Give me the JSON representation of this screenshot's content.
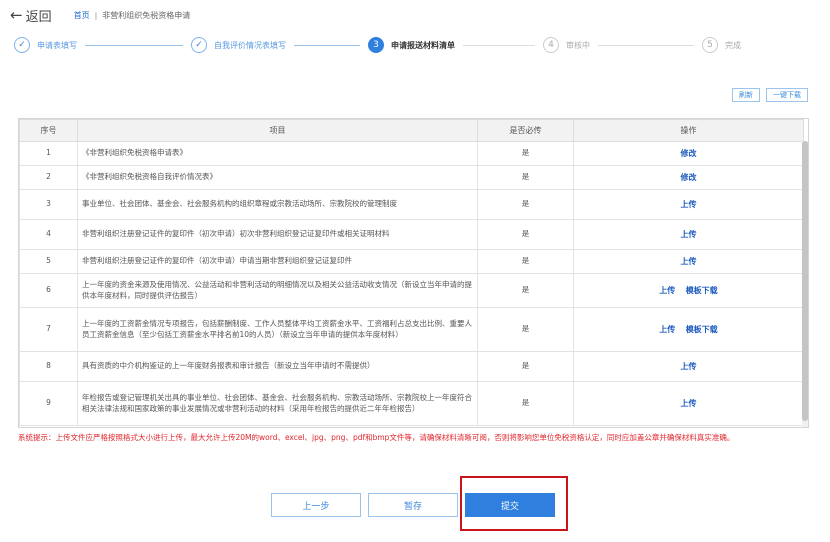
{
  "header": {
    "back_label": "返回",
    "breadcrumb": {
      "home": "首页",
      "separator": "|",
      "current": "非营利组织免税资格申请"
    }
  },
  "steps": [
    {
      "number": "✓",
      "label": "申请表填写",
      "state": "done"
    },
    {
      "number": "✓",
      "label": "自我评价情况表填写",
      "state": "done"
    },
    {
      "number": "3",
      "label": "申请报送材料清单",
      "state": "active"
    },
    {
      "number": "4",
      "label": "审核中",
      "state": "todo"
    },
    {
      "number": "5",
      "label": "完成",
      "state": "todo"
    }
  ],
  "actions": {
    "refresh_label": "刷新",
    "download_all_label": "一键下载"
  },
  "table": {
    "headers": [
      "序号",
      "项目",
      "是否必传",
      "操作"
    ],
    "rows": [
      {
        "idx": "1",
        "item": "《非营利组织免税资格申请表》",
        "required": "是",
        "ops": [
          "修改"
        ]
      },
      {
        "idx": "2",
        "item": "《非营利组织免税资格自我评价情况表》",
        "required": "是",
        "ops": [
          "修改"
        ]
      },
      {
        "idx": "3",
        "item": "事业单位、社会团体、基金会、社会服务机构的组织章程或宗教活动场所、宗教院校的管理制度",
        "required": "是",
        "ops": [
          "上传"
        ]
      },
      {
        "idx": "4",
        "item": "非营利组织注册登记证件的复印件（初次申请）初次非营利组织登记证复印件或相关证明材料",
        "required": "是",
        "ops": [
          "上传"
        ]
      },
      {
        "idx": "5",
        "item": "非营利组织注册登记证件的复印件（初次申请）申请当期非营利组织登记证复印件",
        "required": "是",
        "ops": [
          "上传"
        ]
      },
      {
        "idx": "6",
        "item": "上一年度的资金来源及使用情况、公益活动和非营利活动的明细情况以及相关公益活动收支情况（新设立当年申请的提供本年度材料，同时提供评估报告）",
        "required": "是",
        "ops": [
          "上传",
          "模板下载"
        ]
      },
      {
        "idx": "7",
        "item": "上一年度的工资薪金情况专项报告，包括薪酬制度、工作人员整体平均工资薪金水平、工资福利占总支出比例、重要人员工资薪金信息（至少包括工资薪金水平排名前10的人员）（新设立当年申请的提供本年度材料）",
        "required": "是",
        "ops": [
          "上传",
          "模板下载"
        ]
      },
      {
        "idx": "8",
        "item": "具有资质的中介机构鉴证的上一年度财务报表和审计报告（新设立当年申请时不需提供）",
        "required": "是",
        "ops": [
          "上传"
        ]
      },
      {
        "idx": "9",
        "item": "年检报告或登记管理机关出具的事业单位、社会团体、基金会、社会服务机构、宗教活动场所、宗教院校上一年度符合相关法律法规和国家政策的事业发展情况或非营利活动的材料（采用年检报告的提供近二年年检报告）",
        "required": "是",
        "ops": [
          "上传"
        ]
      }
    ]
  },
  "notice": "系统提示：上传文件应严格按照格式大小进行上传，最大允许上传20M的word、excel、jpg、png、pdf和bmp文件等，请确保材料清晰可阅，否则将影响您单位免税资格认定，同时应加盖公章并确保材料真实准确。",
  "footer": {
    "prev_label": "上一步",
    "save_label": "暂存",
    "submit_label": "提交"
  },
  "colors": {
    "accent": "#2f80de",
    "highlight": "#c8141a",
    "notice": "#e0262d"
  }
}
